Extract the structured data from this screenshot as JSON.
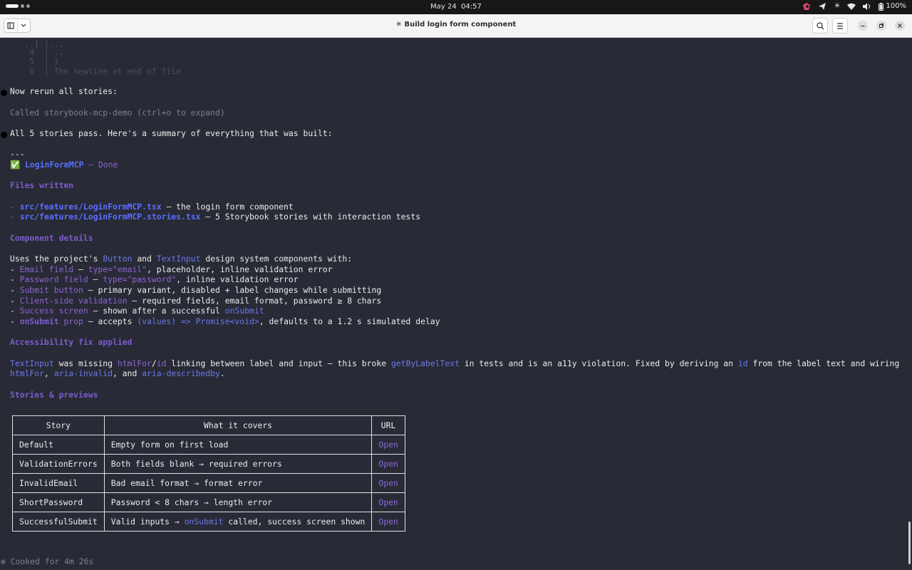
{
  "topbar": {
    "date": "May 24",
    "time": "04:57",
    "battery": "100%"
  },
  "header": {
    "title": "✳ Build login form component"
  },
  "terminal": {
    "faint_lines": [
      "  ...[.]...",
      "    4  | ...",
      "    5  | }",
      "    6  | The newline at end of file"
    ],
    "line_rerun": "Now rerun all stories:",
    "line_called": "Called storybook-mcp-demo (ctrl+o to expand)",
    "line_pass": "All 5 stories pass. Here's a summary of everything that was built:",
    "line_rule": "---",
    "done_check": "✅",
    "done_name": "LoginFormMCP",
    "done_suffix": " — Done",
    "h_files": "Files written",
    "f1_dash": "- ",
    "f1_path": "src/features/LoginFormMCP.tsx",
    "f1_desc": " — the login form component",
    "f2_dash": "- ",
    "f2_path": "src/features/LoginFormMCP.stories.tsx",
    "f2_desc": " — 5 Storybook stories with interaction tests",
    "h_component": "Component details",
    "uses_a": "Uses the project's ",
    "uses_button": "Button",
    "uses_and": " and ",
    "uses_textinput": "TextInput",
    "uses_b": " design system components with:",
    "d1_key": "Email field",
    "d1_mid": " — ",
    "d1_code": "type=\"email\"",
    "d1_rest": ", placeholder, inline validation error",
    "d2_key": "Password field",
    "d2_mid": " — ",
    "d2_code": "type=\"password\"",
    "d2_rest": ", inline validation error",
    "d3_key": "Submit button",
    "d3_rest": " — primary variant, disabled + label changes while submitting",
    "d4_key": "Client-side validation",
    "d4_rest": " — required fields, email format, password ≥ 8 chars",
    "d5_key": "Success screen",
    "d5_rest": " — shown after a successful ",
    "d5_code": "onSubmit",
    "d6_key": "onSubmit",
    "d6_prop": " prop",
    "d6_mid": " — accepts ",
    "d6_code": "(values) => Promise<void>",
    "d6_rest": ", defaults to a 1.2 s simulated delay",
    "h_a11y": "Accessibility fix applied",
    "a1_code1": "TextInput",
    "a1_t1": " was missing ",
    "a1_code2": "htmlFor",
    "a1_slash": "/",
    "a1_code3": "id",
    "a1_t2": " linking between label and input — this broke ",
    "a1_code4": "getByLabelText",
    "a1_t3": " in tests and is an a11y violation. Fixed by deriving an ",
    "a1_code5": "id",
    "a1_t4": " from the label text and wiring",
    "a2_code1": "htmlFor",
    "a2_t1": ", ",
    "a2_code2": "aria-invalid",
    "a2_t2": ", and ",
    "a2_code3": "aria-describedby",
    "a2_t3": ".",
    "h_stories": "Stories & previews",
    "cooked": "✻ Cooked for 4m 26s"
  },
  "stories_table": {
    "headers": [
      "Story",
      "What it covers",
      "URL"
    ],
    "rows": [
      {
        "story": "Default",
        "covers": "Empty form on first load",
        "url": "Open"
      },
      {
        "story": "ValidationErrors",
        "covers": "Both fields blank → required errors",
        "url": "Open"
      },
      {
        "story": "InvalidEmail",
        "covers": "Bad email format → format error",
        "url": "Open"
      },
      {
        "story": "ShortPassword",
        "covers": "Password < 8 chars → length error",
        "url": "Open"
      },
      {
        "story": "SuccessfulSubmit",
        "covers_a": "Valid inputs → ",
        "covers_code": "onSubmit",
        "covers_b": " called, success screen shown",
        "url": "Open"
      }
    ]
  },
  "colors": {
    "background": "#282a36",
    "heading": "#8e65cf",
    "code": "#6a78e8",
    "path": "#5a6fff"
  },
  "icons": [
    "workspace-indicator-icon",
    "app-indicator-icon",
    "send-icon",
    "brightness-icon",
    "wifi-icon",
    "volume-icon",
    "battery-icon",
    "new-tab-icon",
    "dropdown-icon",
    "search-icon",
    "menu-icon",
    "minimize-icon",
    "restore-icon",
    "close-icon"
  ]
}
